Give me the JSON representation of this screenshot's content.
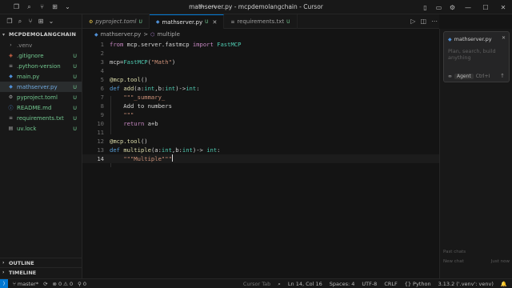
{
  "window": {
    "title": "mathserver.py - mcpdemolangchain - Cursor",
    "controls": {
      "minimize": "—",
      "maximize": "☐",
      "close": "✕"
    }
  },
  "explorer": {
    "folder": "MCPDEMOLANGCHAIN",
    "files": [
      {
        "name": ".venv",
        "badge": "",
        "icon": "folder-icon",
        "state": "dim"
      },
      {
        "name": ".gitignore",
        "badge": "U",
        "icon": "git-icon",
        "state": "git"
      },
      {
        "name": ".python-version",
        "badge": "U",
        "icon": "file-icon",
        "state": "git"
      },
      {
        "name": "main.py",
        "badge": "U",
        "icon": "python-icon",
        "state": "git"
      },
      {
        "name": "mathserver.py",
        "badge": "U",
        "icon": "python-icon",
        "state": "selected"
      },
      {
        "name": "pyproject.toml",
        "badge": "U",
        "icon": "settings-icon",
        "state": "git"
      },
      {
        "name": "README.md",
        "badge": "U",
        "icon": "info-icon",
        "state": "git"
      },
      {
        "name": "requirements.txt",
        "badge": "U",
        "icon": "text-icon",
        "state": "git"
      },
      {
        "name": "uv.lock",
        "badge": "U",
        "icon": "lock-icon",
        "state": "git"
      }
    ],
    "outline_label": "OUTLINE",
    "timeline_label": "TIMELINE"
  },
  "tabs": [
    {
      "label": "pyproject.toml",
      "mod": "U",
      "icon": "toml-icon",
      "active": false,
      "italic": true
    },
    {
      "label": "mathserver.py",
      "mod": "U",
      "icon": "python-icon",
      "active": true,
      "italic": false
    },
    {
      "label": "requirements.txt",
      "mod": "U",
      "icon": "text-icon",
      "active": false,
      "italic": false
    }
  ],
  "breadcrumb": {
    "file": "mathserver.py",
    "separator": ">",
    "symbol": "multiple"
  },
  "editor": {
    "cursor_line": 14,
    "lines": [
      "from mcp.server.fastmcp import FastMCP",
      "",
      "mcp=FastMCP(\"Math\")",
      "",
      "@mcp.tool()",
      "def add(a:int,b:int)->int:",
      "    \"\"\"_summary_",
      "    Add to numbers",
      "    \"\"\"",
      "    return a+b",
      "",
      "@mcp.tool()",
      "def multiple(a:int,b:int)-> int:",
      "    \"\"\"Multiple\"\"\""
    ]
  },
  "chat": {
    "file_label": "mathserver.py",
    "placeholder": "Plan, search, build anything",
    "mode": "Agent",
    "model": "Ctrl+I",
    "send": "↑",
    "history": [
      "Past chats",
      "New chat",
      "Just now"
    ]
  },
  "status": {
    "branch": "master*",
    "errors": "0",
    "warnings": "0",
    "ports": "0",
    "cursor_tab": "Cursor Tab",
    "position": "Ln 14, Col 16",
    "spaces": "Spaces: 4",
    "encoding": "UTF-8",
    "eol": "CRLF",
    "language": "Python",
    "interpreter": "3.13.2 ('.venv': venv)"
  }
}
